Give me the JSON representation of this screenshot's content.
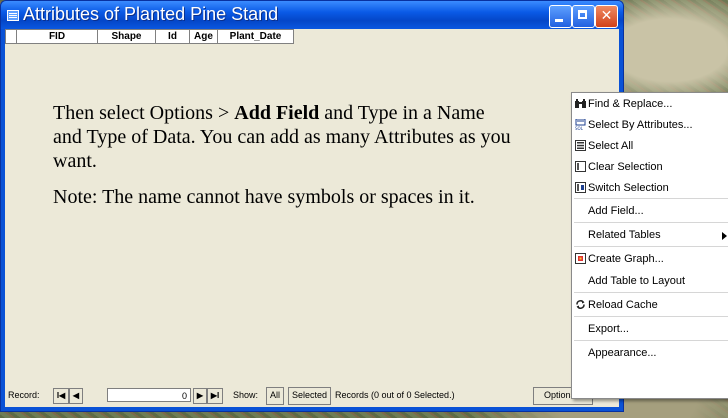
{
  "window": {
    "title": "Attributes of Planted Pine Stand"
  },
  "table": {
    "columns": [
      "FID",
      "Shape",
      "Id",
      "Age",
      "Plant_Date"
    ]
  },
  "overlay": {
    "p1_pre": "Then select Options > ",
    "p1_bold": "Add Field",
    "p1_post": " and Type in a Name and Type of Data. You can add as many Attributes as you want.",
    "p2": "Note: The name cannot have symbols or spaces in it."
  },
  "statusbar": {
    "record_label": "Record:",
    "first": "I◀",
    "prev": "◀",
    "record_value": "0",
    "next": "▶",
    "last": "▶I",
    "show_label": "Show:",
    "all_button": "All",
    "selected_button": "Selected",
    "records_info": "Records (0 out of 0 Selected.)",
    "options_button": "Options ▾"
  },
  "menu": {
    "items": [
      {
        "label": "Find & Replace...",
        "icon": "binoculars-icon"
      },
      {
        "label": "Select By Attributes...",
        "icon": "sql-select-icon"
      },
      {
        "label": "Select All",
        "icon": "select-all-icon"
      },
      {
        "label": "Clear Selection",
        "icon": "clear-selection-icon"
      },
      {
        "label": "Switch Selection",
        "icon": "switch-selection-icon"
      },
      {
        "label": "Add Field...",
        "icon": ""
      },
      {
        "label": "Related Tables",
        "icon": ""
      },
      {
        "label": "Create Graph...",
        "icon": "graph-icon"
      },
      {
        "label": "Add Table to Layout",
        "icon": ""
      },
      {
        "label": "Reload Cache",
        "icon": "reload-icon"
      },
      {
        "label": "Export...",
        "icon": ""
      },
      {
        "label": "Appearance...",
        "icon": ""
      }
    ]
  }
}
